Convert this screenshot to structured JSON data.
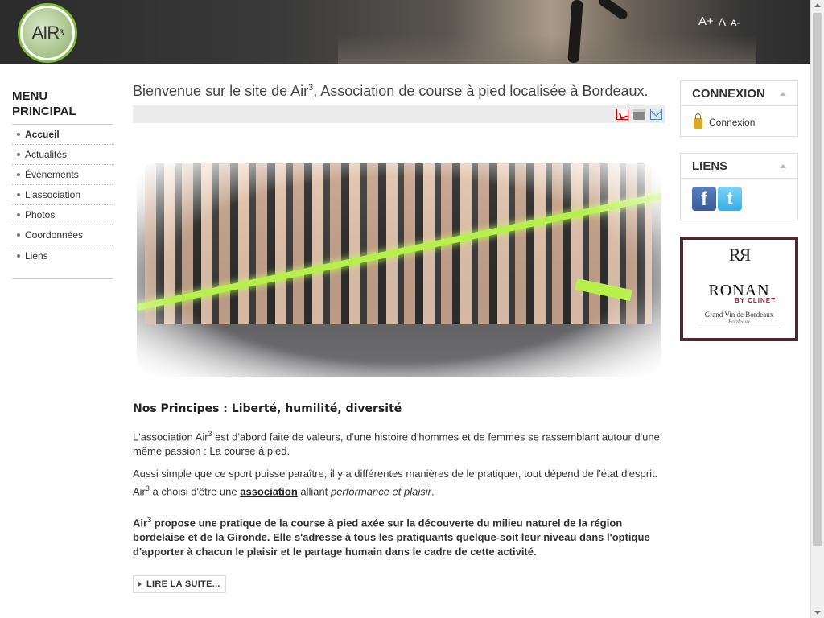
{
  "header": {
    "logo": {
      "text": "AIR",
      "sup": "3"
    },
    "font_controls": {
      "increase": "A+",
      "reset": "A",
      "decrease": "A-"
    }
  },
  "menu": {
    "title": "Menu principal",
    "items": [
      {
        "label": "Accueil",
        "active": true
      },
      {
        "label": "Actualités"
      },
      {
        "label": "Évènements"
      },
      {
        "label": "L'association"
      },
      {
        "label": "Photos"
      },
      {
        "label": "Coordonnées"
      },
      {
        "label": "Liens"
      }
    ]
  },
  "main": {
    "title_pre": "Bienvenue sur le site de Air",
    "title_sup": "3",
    "title_post": ", Association de course à pied localisée à Bordeaux.",
    "section_title": "Nos Principes : Liberté, humilité, diversité",
    "p1_pre": "L'association Air",
    "p1_sup": "3",
    "p1_post": " est d'abord faite de valeurs, d'une histoire d'hommes et de femmes se rassemblant autour d'une même passion : La course à pied.",
    "p2_line1": "Aussi simple que ce sport puisse paraître, il y a différentes manières de le pratiquer, tout dépend de l'état d'esprit.",
    "p2_air": "Air",
    "p2_sup": "3",
    "p2_mid": " a choisi  d'être une ",
    "p2_link": "association",
    "p2_post_pre": " alliant ",
    "p2_em": "performance et plaisir",
    "p2_end": ".",
    "p3_pre": "Air",
    "p3_sup": "3",
    "p3_post": " propose une pratique de la course à pied axée sur la découverte du milieu naturel de la région bordelaise et de la Gironde. Elle s'adresse à tous les pratiquants quelque-soit leur niveau dans l'optique d'apporter à chacun le plaisir et le partage humain dans le cadre de cette activité.",
    "read_more": "Lire la suite..."
  },
  "sidebar": {
    "login": {
      "title": "Connexion",
      "link": "Connexion"
    },
    "links": {
      "title": "Liens",
      "facebook_glyph": "f",
      "twitter_glyph": "t"
    },
    "ad": {
      "monogram": "RЯ",
      "brand": "RONAN",
      "brand_sub": "BY CLINET",
      "line1": "Grand Vin de Bordeaux",
      "line2": "Bordeaux"
    }
  },
  "colors": {
    "accent_green": "#b6f04a",
    "facebook": "#3b5998",
    "twitter": "#33aee6"
  }
}
